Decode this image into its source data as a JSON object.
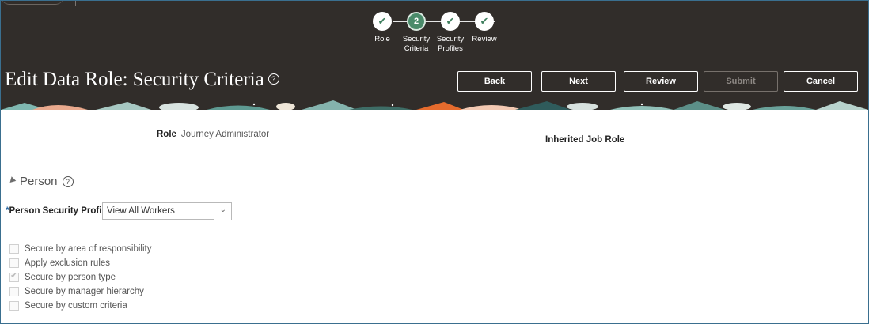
{
  "train": {
    "steps": [
      {
        "label_line1": "Role",
        "label_line2": "",
        "state": "complete",
        "icon": "check-icon"
      },
      {
        "label_line1": "Security",
        "label_line2": "Criteria",
        "state": "current",
        "number": "2"
      },
      {
        "label_line1": "Security",
        "label_line2": "Profiles",
        "state": "complete",
        "icon": "check-icon"
      },
      {
        "label_line1": "Review",
        "label_line2": "",
        "state": "complete",
        "icon": "check-icon"
      }
    ]
  },
  "header": {
    "title": "Edit Data Role: Security Criteria",
    "help_icon": "question-circle-icon",
    "buttons": {
      "back": {
        "pre": "",
        "mnemonic": "B",
        "post": "ack"
      },
      "next": {
        "pre": "Ne",
        "mnemonic": "x",
        "post": "t"
      },
      "review": {
        "label": "Review"
      },
      "submit": {
        "pre": "Su",
        "mnemonic": "b",
        "post": "mit",
        "disabled": true
      },
      "cancel": {
        "pre": "",
        "mnemonic": "C",
        "post": "ancel"
      }
    }
  },
  "details": {
    "role_label": "Role",
    "role_value": "Journey Administrator",
    "inherited_label": "Inherited Job Role"
  },
  "person_section": {
    "title": "Person",
    "profile_required_mark": "*",
    "profile_label": "Person Security Profile",
    "profile_value": "View All Workers",
    "checkboxes": [
      {
        "label": "Secure by area of responsibility",
        "checked": false
      },
      {
        "label": "Apply exclusion rules",
        "checked": false
      },
      {
        "label": "Secure by person type",
        "checked": true
      },
      {
        "label": "Secure by manager hierarchy",
        "checked": false
      },
      {
        "label": "Secure by custom criteria",
        "checked": false
      }
    ]
  },
  "colors": {
    "header_bg": "#312d2a",
    "step_active": "#4a8b6a",
    "required": "#2d6aa3"
  }
}
